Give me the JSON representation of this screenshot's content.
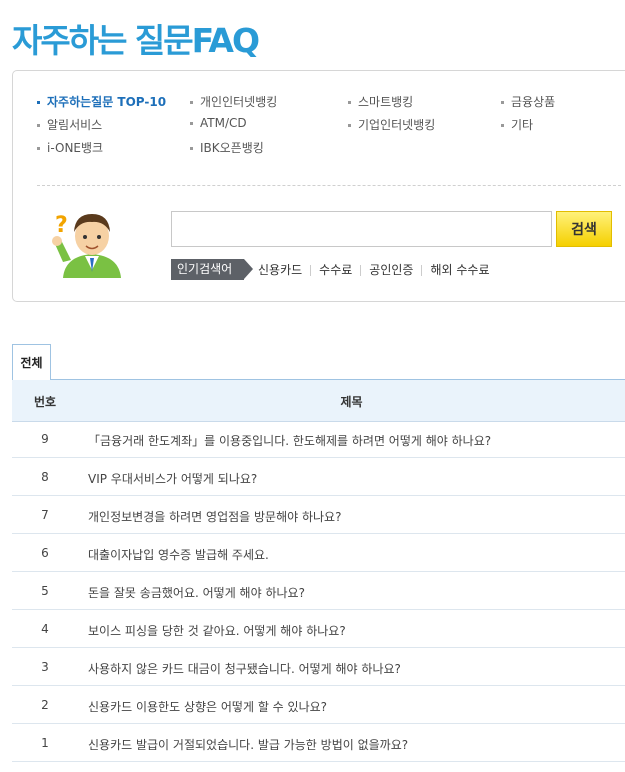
{
  "page_title": "자주하는 질문FAQ",
  "categories": [
    {
      "label": "자주하는질문 TOP-10",
      "active": true
    },
    {
      "label": "개인인터넷뱅킹"
    },
    {
      "label": "스마트뱅킹"
    },
    {
      "label": "금융상품"
    },
    {
      "label": "알림서비스"
    },
    {
      "label": "ATM/CD"
    },
    {
      "label": "기업인터넷뱅킹"
    },
    {
      "label": "기타"
    },
    {
      "label": "i-ONE뱅크"
    },
    {
      "label": "IBK오픈뱅킹"
    }
  ],
  "search": {
    "placeholder": "",
    "button_label": "검색"
  },
  "popular": {
    "label": "인기검색어",
    "keywords": [
      "신용카드",
      "수수료",
      "공인인증",
      "해외 수수료"
    ]
  },
  "tabs": [
    {
      "label": "전체"
    }
  ],
  "table": {
    "headers": {
      "number": "번호",
      "title": "제목"
    },
    "rows": [
      {
        "number": "9",
        "title": "「금융거래 한도계좌」를 이용중입니다. 한도해제를 하려면 어떻게 해야 하나요?"
      },
      {
        "number": "8",
        "title": "VIP 우대서비스가 어떻게 되나요?"
      },
      {
        "number": "7",
        "title": "개인정보변경을 하려면 영업점을 방문해야 하나요?"
      },
      {
        "number": "6",
        "title": "대출이자납입 영수증 발급해 주세요."
      },
      {
        "number": "5",
        "title": "돈을 잘못 송금했어요. 어떻게 해야 하나요?"
      },
      {
        "number": "4",
        "title": "보이스 피싱을 당한 것 같아요. 어떻게 해야 하나요?"
      },
      {
        "number": "3",
        "title": "사용하지 않은 카드 대금이 청구됐습니다. 어떻게 해야 하나요?"
      },
      {
        "number": "2",
        "title": "신용카드 이용한도 상향은 어떻게 할 수 있나요?"
      },
      {
        "number": "1",
        "title": "신용카드 발급이 거절되었습니다. 발급 가능한 방법이 없을까요?"
      }
    ]
  },
  "colors": {
    "accent": "#2a9bd6",
    "active_category": "#1d6fb9",
    "header_bg": "#eaf3fb",
    "search_button": "#f5d000"
  }
}
